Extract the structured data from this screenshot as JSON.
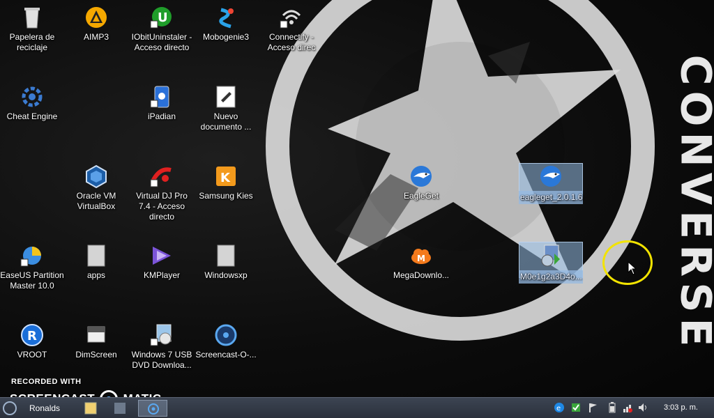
{
  "desktop": {
    "icons": [
      {
        "label": "Papelera de reciclaje",
        "icon": "recycle-bin-icon"
      },
      {
        "label": "AIMP3",
        "icon": "aimp-icon"
      },
      {
        "label": "IObitUninstaler - Acceso directo",
        "icon": "iobit-uninstaller-icon"
      },
      {
        "label": "Mobogenie3",
        "icon": "mobogenie-icon"
      },
      {
        "label": "Connectify - Acceso direc",
        "icon": "connectify-icon"
      },
      {
        "label": "Cheat Engine",
        "icon": "cheat-engine-icon"
      },
      {
        "label": "iPadian",
        "icon": "ipadian-icon"
      },
      {
        "label": "Nuevo documento ...",
        "icon": "document-icon"
      },
      {
        "label": "Oracle VM VirtualBox",
        "icon": "virtualbox-icon"
      },
      {
        "label": "Virtual DJ Pro 7.4 - Acceso directo",
        "icon": "virtual-dj-icon"
      },
      {
        "label": "Samsung Kies",
        "icon": "samsung-kies-icon"
      },
      {
        "label": "EagleGet",
        "icon": "eagleget-icon"
      },
      {
        "label": "eagleget_2.0.1.6",
        "icon": "eagleget-installer-icon"
      },
      {
        "label": "EaseUS Partition Master 10.0",
        "icon": "easeus-icon"
      },
      {
        "label": "apps",
        "icon": "file-icon"
      },
      {
        "label": "KMPlayer",
        "icon": "kmplayer-icon"
      },
      {
        "label": "Windowsxp",
        "icon": "file-icon"
      },
      {
        "label": "MegaDownlo...",
        "icon": "megadownloader-icon"
      },
      {
        "label": "M0e1g2a3D4o...",
        "icon": "setup-installer-icon"
      },
      {
        "label": "VROOT",
        "icon": "vroot-icon"
      },
      {
        "label": "DimScreen",
        "icon": "dimscreen-icon"
      },
      {
        "label": "Windows 7 USB DVD Downloa...",
        "icon": "windows-usb-tool-icon"
      },
      {
        "label": "Screencast-O-...",
        "icon": "screencast-icon"
      }
    ],
    "wallpaper_text": "CONVERSE"
  },
  "watermark": {
    "recorded": "RECORDED WITH",
    "logo_left": "SCREENCAST",
    "logo_right": "MATIC"
  },
  "taskbar": {
    "user": "Ronalds",
    "clock": "3:03 p. m."
  },
  "colors": {
    "selection": "#96b9e1",
    "cursor_highlight": "#f2e300",
    "taskbar": "#2b313c"
  }
}
